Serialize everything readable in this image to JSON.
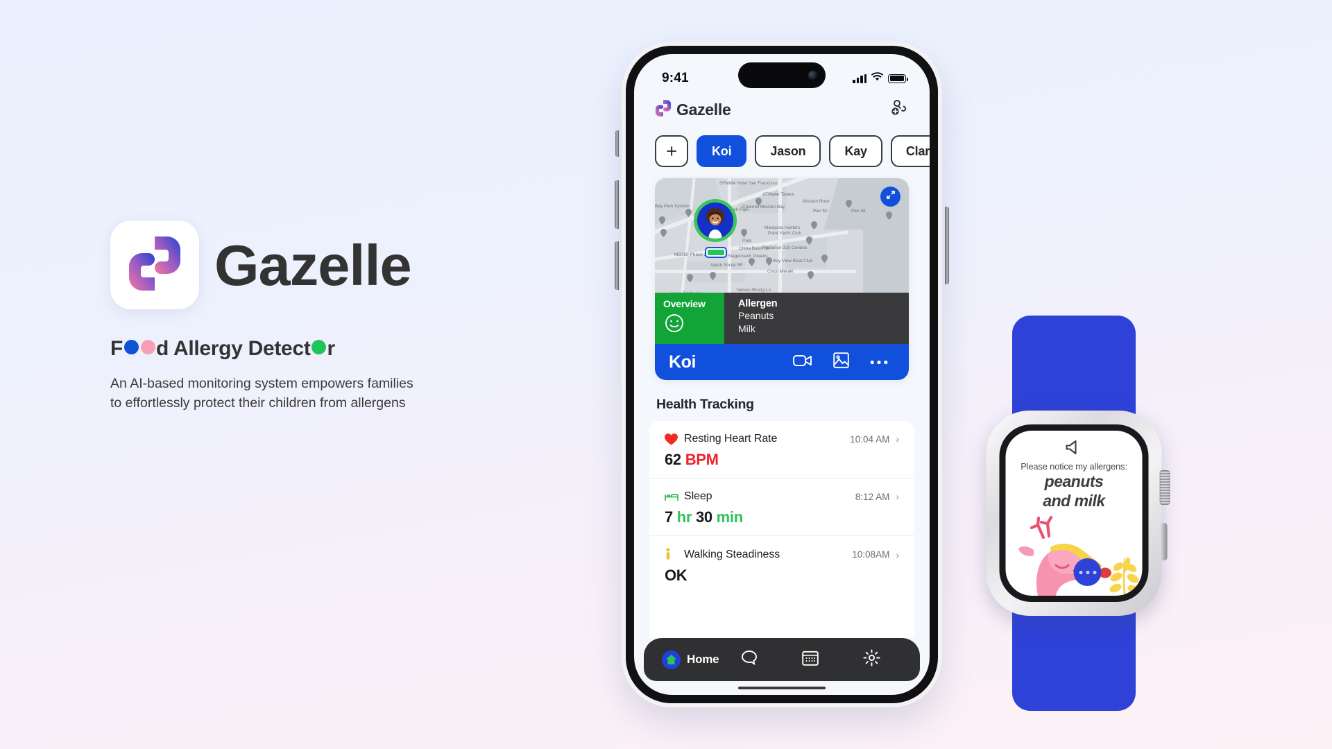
{
  "branding": {
    "app_name": "Gazelle",
    "app_icon": "gazelle-logo-icon",
    "tagline_pre": "F",
    "tagline_mid": "d Allergy Detect",
    "tagline_post": "r",
    "tagline_full": "Food Allergy Detector",
    "subtitle": "An AI-based monitoring system empowers families to effortlessly protect their children from allergens",
    "accent_blue": "#1052d6",
    "accent_pink": "#f7a0b5",
    "accent_green": "#1fc45a"
  },
  "phone": {
    "statusbar": {
      "time": "9:41",
      "signal_icon": "cellular-signal-icon",
      "wifi_icon": "wifi-icon",
      "battery_icon": "battery-icon"
    },
    "header": {
      "brand": "Gazelle",
      "logo_icon": "gazelle-logo-icon",
      "add_member_icon": "add-family-member-icon"
    },
    "chips": [
      {
        "label": "+",
        "active": false,
        "kind": "add"
      },
      {
        "label": "Koi",
        "active": true,
        "kind": "person"
      },
      {
        "label": "Jason",
        "active": false,
        "kind": "person"
      },
      {
        "label": "Kay",
        "active": false,
        "kind": "person"
      },
      {
        "label": "Clara",
        "active": false,
        "kind": "person"
      }
    ],
    "map": {
      "expand_icon": "expand-fullscreen-icon",
      "avatar_name": "Koi",
      "battery_level": "full",
      "labels": [
        "SFMMA Hotel San Francisco",
        "ATWater Tavern",
        "Mission Rock",
        "Pier 50",
        "Pier 48",
        "Bay Park System",
        "Mission Creek Park",
        "Channel Mission Bay",
        "Mariposa Hunters Point Yacht Club",
        "Park",
        "China Basin St",
        "Radiance 325 Condos",
        "MB360 Phase 2",
        "Stagecoach Greens",
        "Spark Social SF",
        "Bay View Boat Club",
        "Cisco Meraki",
        "Nelson Rising Ln",
        "Long Bridge Ln"
      ]
    },
    "overview": {
      "title": "Overview",
      "icon": "smiley-face-icon",
      "status": "ok"
    },
    "allergen": {
      "title": "Allergen",
      "items": [
        "Peanuts",
        "Milk"
      ]
    },
    "name_bar": {
      "name": "Koi",
      "icons": [
        "video-call-icon",
        "photo-gallery-icon",
        "more-options-icon"
      ]
    },
    "health": {
      "section_title": "Health Tracking",
      "rows": [
        {
          "icon": "heart-icon",
          "label": "Resting Heart Rate",
          "time": "10:04 AM",
          "chevron": "›",
          "value": "62",
          "unit": "BPM",
          "unit_color": "red",
          "has_bars": false
        },
        {
          "icon": "bed-sleep-icon",
          "label": "Sleep",
          "time": "8:12 AM",
          "chevron": "›",
          "value": "7",
          "unit": "hr",
          "value2": "30",
          "unit2": "min",
          "unit_color": "green",
          "has_bars": false
        },
        {
          "icon": "walking-person-icon",
          "label": "Walking Steadiness",
          "time": "10:08AM",
          "chevron": "›",
          "value": "OK",
          "unit": "",
          "unit_color": "none",
          "has_bars": true,
          "bar_fill_pct": 55
        }
      ]
    },
    "bottom_nav": [
      {
        "label": "Home",
        "icon": "home-icon",
        "active": true
      },
      {
        "label": "",
        "icon": "chat-bubble-icon",
        "active": false
      },
      {
        "label": "",
        "icon": "calendar-icon",
        "active": false
      },
      {
        "label": "",
        "icon": "settings-gear-icon",
        "active": false
      }
    ]
  },
  "watch": {
    "speaker_icon": "speaker-volume-icon",
    "lead_text": "Please notice my allergens:",
    "allergen_text_line1": "peanuts",
    "allergen_text_line2": "and milk",
    "illustration": "pink-deer-mascot-illustration",
    "more_button_icon": "more-options-icon",
    "crown_icon": "digital-crown-icon",
    "side_button_icon": "watch-side-button-icon",
    "band_color": "#2e42d8",
    "case_color": "#e4e4e8"
  }
}
